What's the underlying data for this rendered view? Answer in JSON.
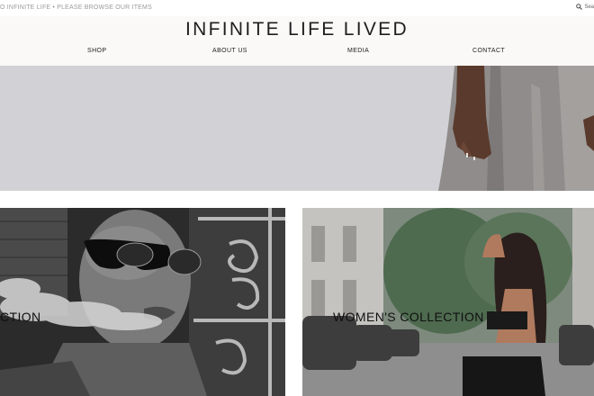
{
  "announcement": "O INFINITE LIFE • PLEASE BROWSE OUR ITEMS",
  "search": {
    "label": "Sea",
    "icon": "search-icon"
  },
  "header": {
    "title": "INFINITE LIFE LIVED"
  },
  "nav": [
    {
      "label": "SHOP"
    },
    {
      "label": "ABOUT  US"
    },
    {
      "label": "MEDIA"
    },
    {
      "label": "CONTACT"
    }
  ],
  "collections": {
    "men": {
      "label": "CTION"
    },
    "women": {
      "label": "WOMEN'S COLLECTION"
    }
  },
  "colors": {
    "header_bg": "#faf9f7",
    "hero_bg": "#d2d1d5",
    "text": "#1e1e1e"
  }
}
